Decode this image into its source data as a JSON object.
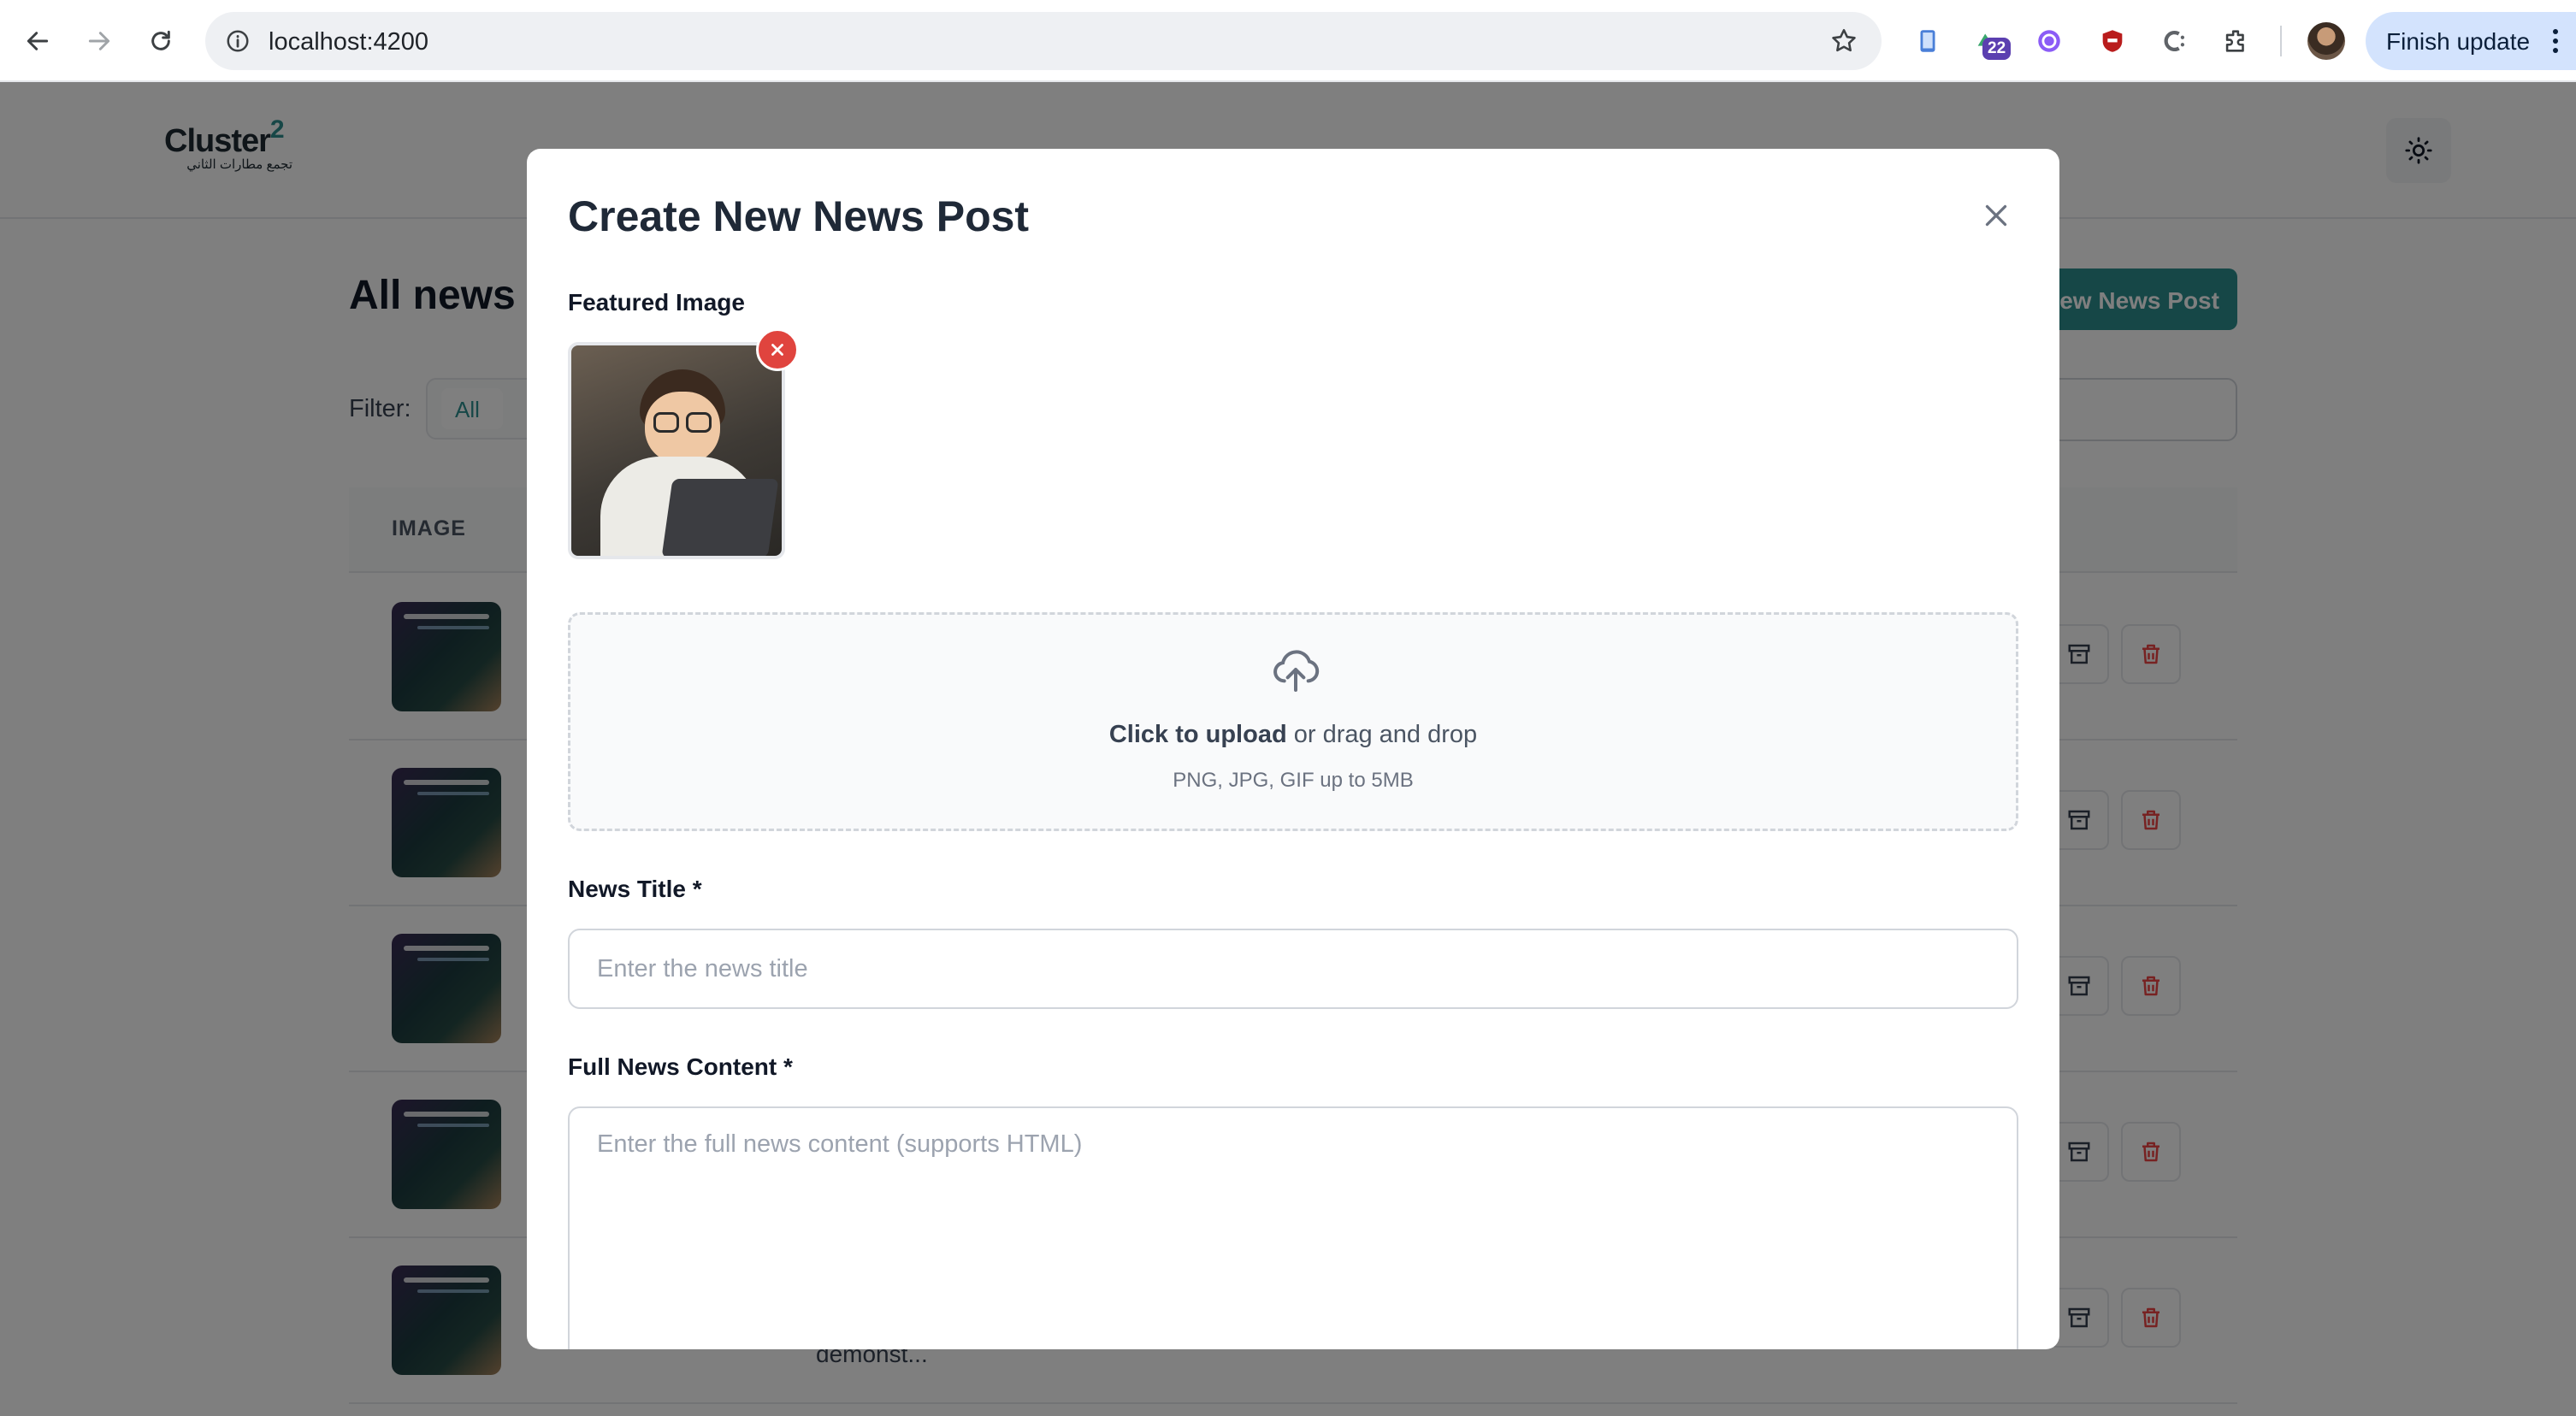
{
  "browser": {
    "url": "localhost:4200",
    "extension_badge": "22",
    "finish_update_label": "Finish update"
  },
  "app": {
    "logo_word": "Cluster",
    "logo_sup": "2",
    "logo_sub": "تجمع مطارات الثاني",
    "page_title": "All news posts",
    "new_post_button": "New News Post",
    "filter_label": "Filter:",
    "filter_all": "All",
    "image_column_header": "IMAGE",
    "last_row_excerpt": "demonst..."
  },
  "modal": {
    "title": "Create New News Post",
    "featured_image_label": "Featured Image",
    "upload_click": "Click to upload",
    "upload_rest": " or drag and drop",
    "upload_hint": "PNG, JPG, GIF up to 5MB",
    "title_label": "News Title *",
    "title_placeholder": "Enter the news title",
    "content_label": "Full News Content *",
    "content_placeholder": "Enter the full news content (supports HTML)"
  },
  "colors": {
    "accent": "#2d8f8f",
    "danger": "#e0443e",
    "finish_update_bg": "#d3e3fd"
  }
}
